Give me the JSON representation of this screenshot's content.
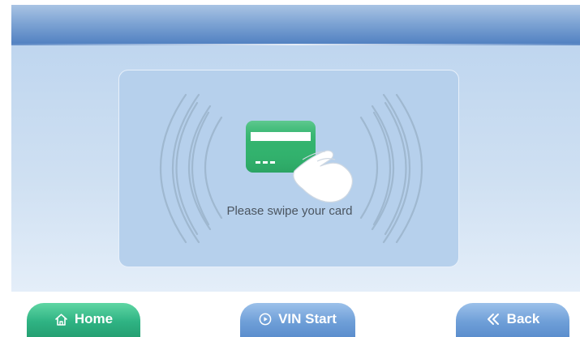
{
  "main": {
    "prompt": "Please swipe your card"
  },
  "footer": {
    "home_label": "Home",
    "vin_start_label": "VIN Start",
    "back_label": "Back"
  },
  "icons": {
    "home": "home-icon",
    "vin_start": "play-circle-icon",
    "back": "double-chevron-left-icon",
    "illustration": "card-swipe-illustration"
  },
  "colors": {
    "header": "#5f8ac6",
    "panel": "#b6d0ec",
    "home_button": "#2fb383",
    "nav_button": "#6f9fd8",
    "card": "#33b36e"
  }
}
